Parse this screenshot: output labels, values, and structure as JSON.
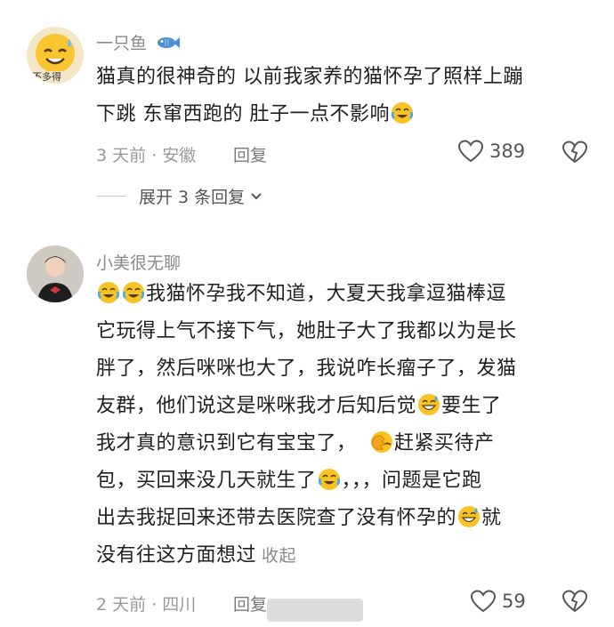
{
  "comments": [
    {
      "username": "一只鱼",
      "avatar_caption": "不多得",
      "line1": "猫真的很神奇的 以前我家养的猫怀孕了照样上蹦",
      "line2": "下跳 东窜西跑的 肚子一点不影响",
      "time": "3 天前",
      "location": "安徽",
      "reply_label": "回复",
      "likes": "389",
      "expand_label": "展开 3 条回复"
    },
    {
      "username": "小美很无聊",
      "lines": [
        "我猫怀孕我不知道，大夏天我拿逗猫棒逗",
        "它玩得上气不接下气，她肚子大了我都以为是长",
        "胖了，然后咪咪也大了，我说咋长瘤子了，发猫",
        "友群，他们说这是咪咪我才后知后觉",
        "要生了",
        "我才真的意识到它有宝宝了，",
        "赶紧买待产",
        "包，买回来没几天就生了",
        "，，，问题是它跑",
        "出去我捉回来还带去医院查了没有怀孕的",
        "就",
        "没有往这方面想过"
      ],
      "fold_label": "收起",
      "time": "2 天前",
      "location": "四川",
      "reply_label": "回复",
      "likes": "59"
    }
  ],
  "icons": {
    "fish": "fish-icon",
    "heart": "heart-outline-icon",
    "broken_heart": "broken-heart-icon",
    "chevron": "chevron-down-icon",
    "emoji_cry": "crying-laughing-emoji",
    "emoji_grin": "grinning-sweat-emoji",
    "emoji_facepalm": "facepalm-emoji"
  },
  "colors": {
    "text": "#1f1f1f",
    "meta": "#9a9a9a",
    "emoji": "#f7c325"
  }
}
